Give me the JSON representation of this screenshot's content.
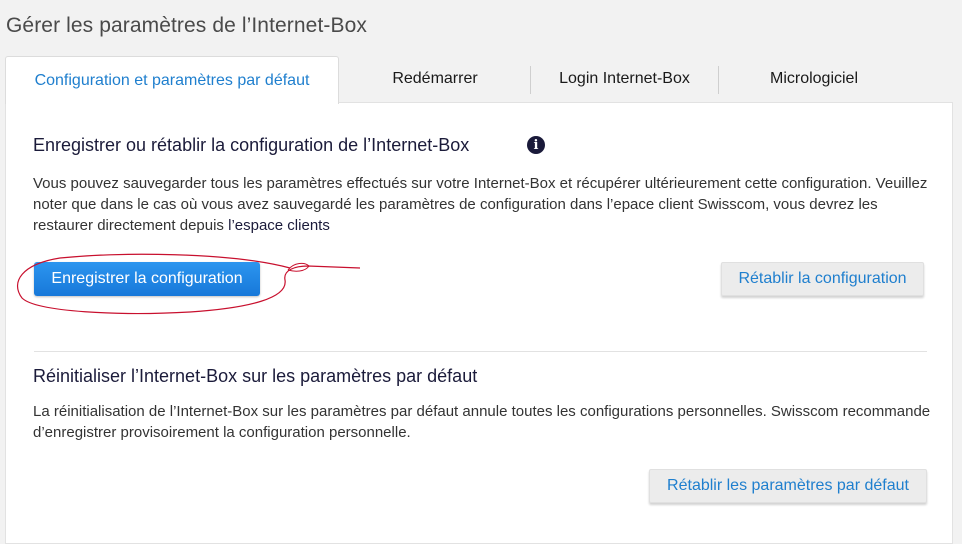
{
  "page": {
    "title": "Gérer les paramètres de l’Internet-Box"
  },
  "tabs": [
    {
      "label": "Configuration et paramètres par défaut",
      "active": true
    },
    {
      "label": "Redémarrer",
      "active": false
    },
    {
      "label": "Login Internet-Box",
      "active": false
    },
    {
      "label": "Micrologiciel",
      "active": false
    }
  ],
  "backup_section": {
    "title": "Enregistrer ou rétablir la configuration de l’Internet-Box",
    "info_icon": "info-icon",
    "description": "Vous pouvez sauvegarder tous les paramètres effectués sur votre Internet-Box et récupérer ultérieurement cette configuration. Veuillez noter que dans le cas où vous avez sauvegardé les paramètres de configuration dans l’epace client Swisscom, vous devrez les restaurer directement depuis ",
    "link_text": "l’espace clients",
    "save_button": "Enregistrer la configuration",
    "restore_button": "Rétablir la configuration"
  },
  "reset_section": {
    "title": "Réinitialiser l’Internet-Box sur les paramètres par défaut",
    "description": "La réinitialisation de l’Internet-Box sur les paramètres par défaut annule toutes les configurations personnelles. Swisscom recommande d’enregistrer provisoirement la configuration personnelle.",
    "reset_button": "Rétablir les paramètres par défaut"
  },
  "colors": {
    "accent": "#1f7fce",
    "primary_button": "#1778d9",
    "annotation_stroke": "#c8102e"
  }
}
